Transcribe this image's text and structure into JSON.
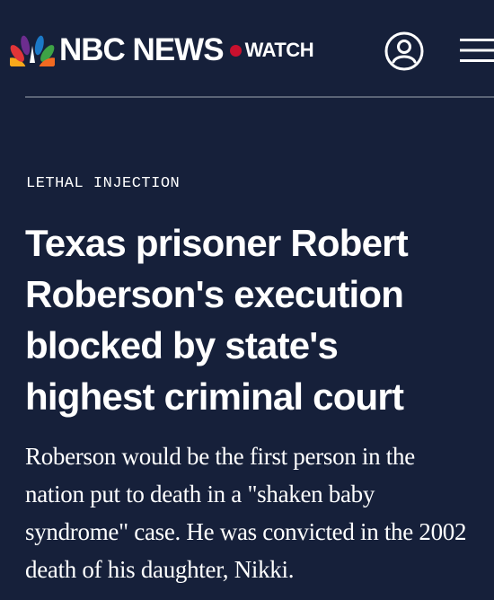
{
  "header": {
    "brand": "NBC NEWS",
    "watch_label": "WATCH",
    "icons": {
      "logo": "nbc-peacock-icon",
      "account": "account-icon",
      "menu": "hamburger-menu-icon"
    }
  },
  "article": {
    "kicker": "LETHAL INJECTION",
    "headline": "Texas prisoner Robert Roberson's execution blocked by state's highest criminal court",
    "dek": "Roberson would be the first person in the nation put to death in a \"shaken baby syndrome\" case. He was convicted in the 2002 death of his daughter, Nikki."
  },
  "colors": {
    "background": "#16203a",
    "text": "#ffffff",
    "live_dot": "#c8102e",
    "divider": "#5b6476"
  }
}
